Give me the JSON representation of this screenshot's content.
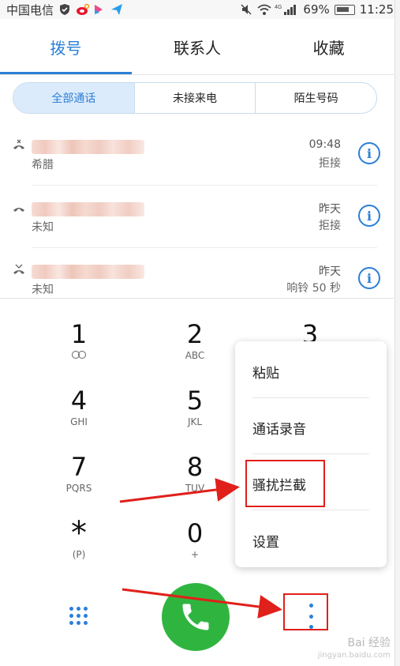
{
  "status_bar": {
    "carrier": "中国电信",
    "battery_text": "69%",
    "time": "11:25",
    "network_label": "4G"
  },
  "tabs": [
    {
      "label": "拨号",
      "active": true
    },
    {
      "label": "联系人",
      "active": false
    },
    {
      "label": "收藏",
      "active": false
    }
  ],
  "filters": [
    {
      "label": "全部通话",
      "active": true
    },
    {
      "label": "未接来电",
      "active": false
    },
    {
      "label": "陌生号码",
      "active": false
    }
  ],
  "calls": [
    {
      "name": "希腊",
      "time": "09:48",
      "status": "拒接"
    },
    {
      "name": "未知",
      "time": "昨天",
      "status": "拒接"
    },
    {
      "name": "未知",
      "time": "昨天",
      "status": "响铃 50 秒"
    }
  ],
  "keypad": [
    {
      "digit": "1",
      "letters": ""
    },
    {
      "digit": "2",
      "letters": "ABC"
    },
    {
      "digit": "3",
      "letters": ""
    },
    {
      "digit": "4",
      "letters": "GHI"
    },
    {
      "digit": "5",
      "letters": "JKL"
    },
    {
      "digit": "7",
      "letters": "PQRS"
    },
    {
      "digit": "8",
      "letters": "TUV"
    },
    {
      "digit": "*",
      "letters": "(P)"
    },
    {
      "digit": "0",
      "letters": "+"
    }
  ],
  "menu": {
    "items": [
      "粘贴",
      "通话录音",
      "骚扰拦截",
      "设置"
    ]
  },
  "watermark": {
    "text": "Bai 经验",
    "url": "jingyan.baidu.com"
  },
  "colors": {
    "accent": "#2b7fd6",
    "call_green": "#2fb53f",
    "annotation_red": "#e0201b"
  }
}
